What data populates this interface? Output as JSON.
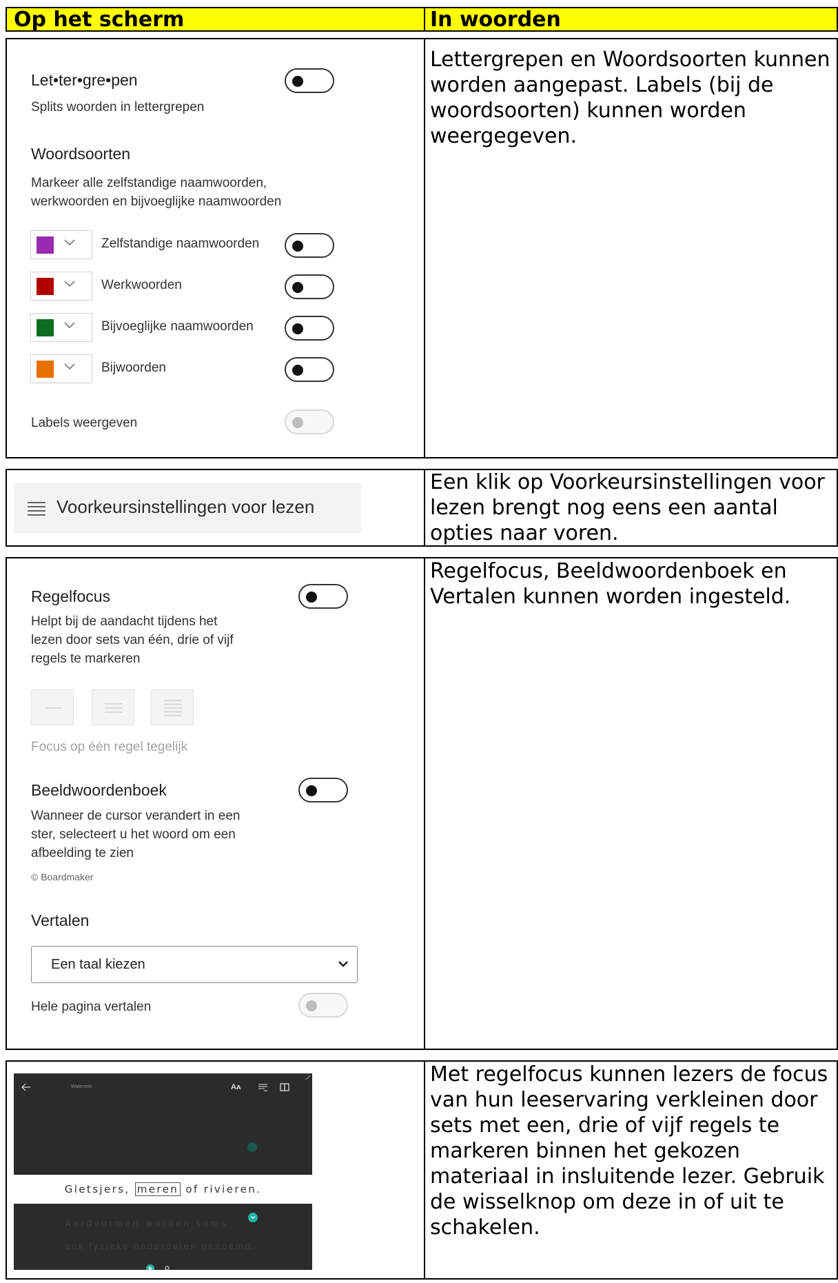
{
  "header": {
    "col1": "Op het scherm",
    "col2": "In woorden"
  },
  "row1": {
    "syllables": {
      "title": "Let•ter•gre•pen",
      "desc": "Splits woorden in lettergrepen"
    },
    "parts_of_speech": {
      "title": "Woordsoorten",
      "desc_line1": "Markeer alle zelfstandige naamwoorden,",
      "desc_line2": "werkwoorden en bijvoeglijke naamwoorden",
      "items": [
        {
          "label": "Zelfstandige naamwoorden",
          "color": "#9a2ab2"
        },
        {
          "label": "Werkwoorden",
          "color": "#b00000"
        },
        {
          "label": "Bijvoeglijke naamwoorden",
          "color": "#0a6e1e"
        },
        {
          "label": "Bijwoorden",
          "color": "#e87200"
        }
      ]
    },
    "labels_toggle": "Labels weergeven",
    "description": "Lettergrepen en Woordsoorten kunnen worden aangepast. Labels (bij de woordsoorten) kunnen worden weergegeven."
  },
  "row2": {
    "button_label": "Voorkeursinstellingen voor lezen",
    "description": "Een klik op Voorkeursinstellingen voor lezen brengt nog eens een aantal opties naar voren."
  },
  "row3": {
    "line_focus": {
      "title": "Regelfocus",
      "desc_line1": "Helpt bij de aandacht tijdens het",
      "desc_line2": "lezen door sets van één, drie of vijf",
      "desc_line3": "regels te markeren",
      "caption": "Focus op één regel tegelijk"
    },
    "picture_dictionary": {
      "title": "Beeldwoordenboek",
      "desc_line1": "Wanneer de cursor verandert in een",
      "desc_line2": "ster, selecteert u het woord om een",
      "desc_line3": "afbeelding te zien",
      "credit": "© Boardmaker"
    },
    "translate": {
      "title": "Vertalen",
      "select_value": "Een taal kiezen",
      "page_toggle": "Hele pagina vertalen"
    },
    "description": "Regelfocus, Beeldwoordenboek en Vertalen kunnen worden ingesteld."
  },
  "row4": {
    "reader": {
      "title": "Waterrem",
      "focused_line_before": "Gletsjers,",
      "focused_word": "meren",
      "focused_line_after": "of rivieren.",
      "line2": "Aardvormen worden soms",
      "line3": "ook fysieke onderdelen genoemd."
    },
    "description": "Met regelfocus kunnen lezers de focus van hun leeservaring verkleinen door sets met een, drie of vijf regels te markeren binnen het gekozen materiaal in insluitende lezer. Gebruik de wisselknop om deze in of uit te schakelen."
  }
}
